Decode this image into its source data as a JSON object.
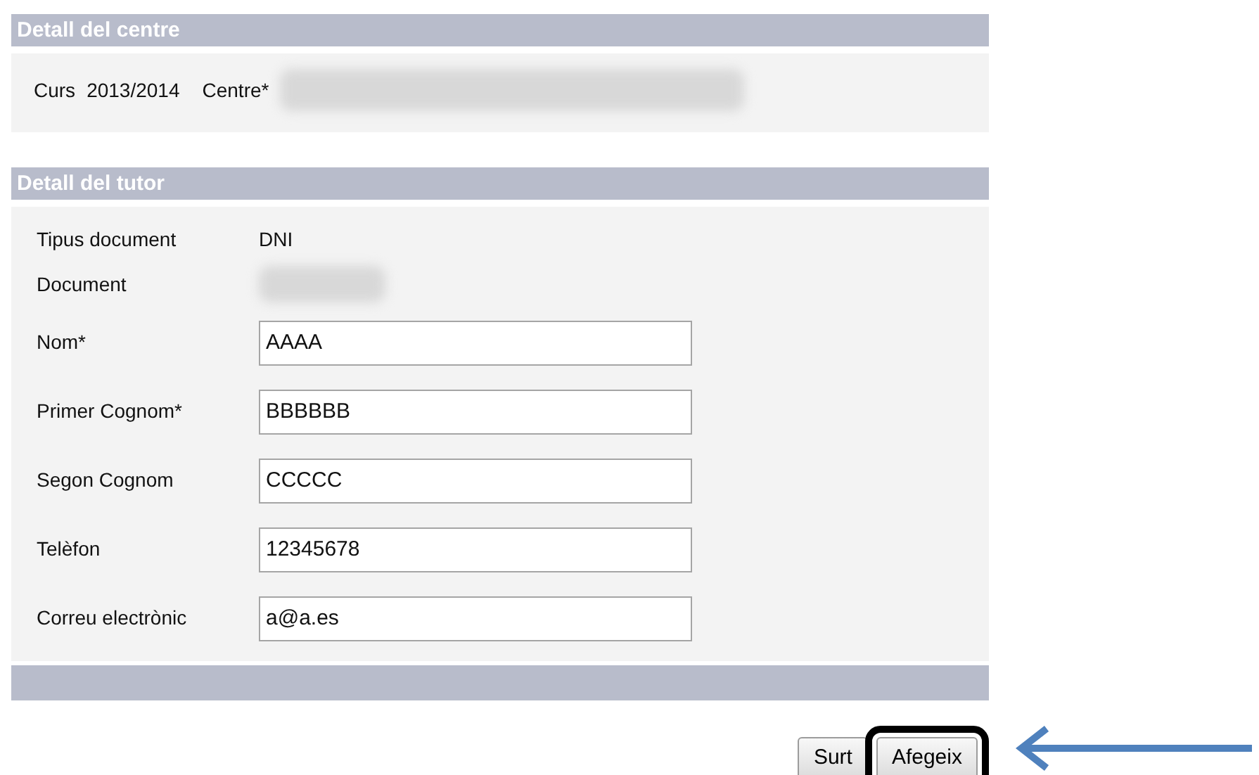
{
  "sections": [
    {
      "title": "Detall del centre",
      "kind": "inline",
      "items": [
        {
          "label": "Curs",
          "value": "2013/2014"
        },
        {
          "label": "Centre*",
          "redacted": true
        }
      ]
    },
    {
      "title": "Detall del tutor",
      "kind": "form",
      "rows": [
        {
          "kind": "text",
          "label": "Tipus document",
          "value": "DNI"
        },
        {
          "kind": "redacted",
          "label": "Document"
        },
        {
          "kind": "input",
          "label": "Nom*",
          "value": "AAAA"
        },
        {
          "kind": "input",
          "label": "Primer Cognom*",
          "value": "BBBBBB"
        },
        {
          "kind": "input",
          "label": "Segon Cognom",
          "value": "CCCCC"
        },
        {
          "kind": "input",
          "label": "Telèfon",
          "value": "12345678"
        },
        {
          "kind": "input",
          "label": "Correu electrònic",
          "value": "a@a.es"
        }
      ]
    }
  ],
  "buttons": [
    {
      "label": "Surt",
      "highlighted": false
    },
    {
      "label": "Afegeix",
      "highlighted": true
    }
  ]
}
